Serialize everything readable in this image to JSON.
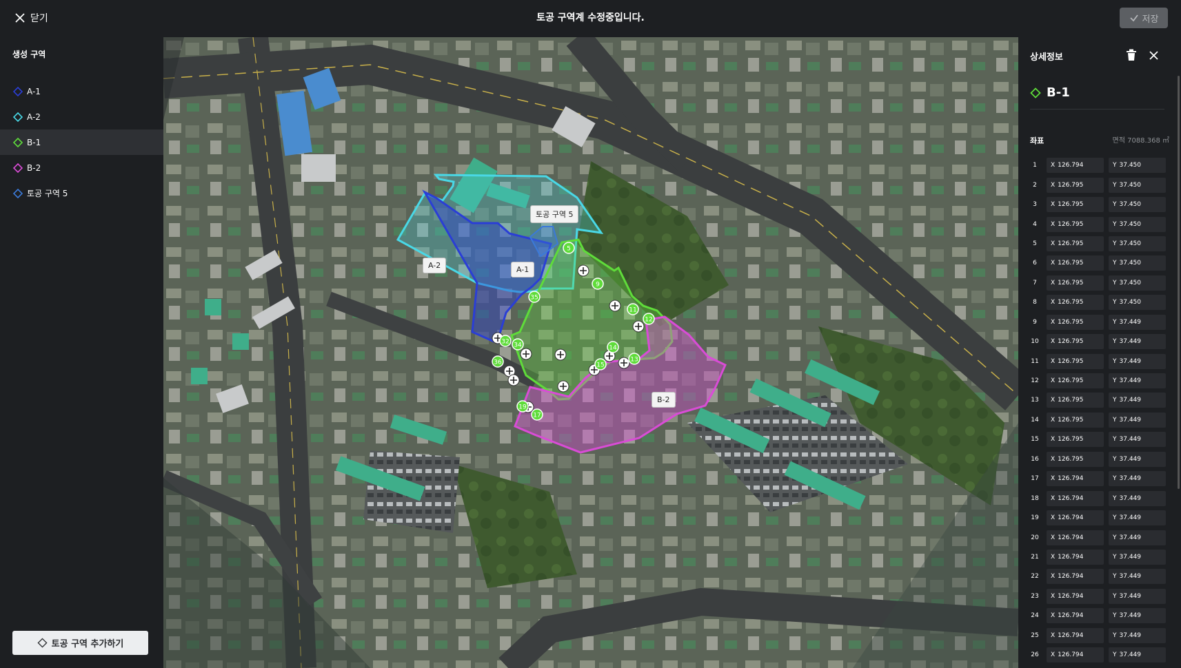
{
  "header": {
    "close_label": "닫기",
    "title": "토공 구역계 수정중입니다.",
    "save_label": "저장"
  },
  "sidebar": {
    "title": "생성 구역",
    "items": [
      {
        "label": "A-1",
        "color": "#2a3ed6"
      },
      {
        "label": "A-2",
        "color": "#49d8e6"
      },
      {
        "label": "B-1",
        "color": "#5fdc3a",
        "selected": true
      },
      {
        "label": "B-2",
        "color": "#d94cd6"
      },
      {
        "label": "토공 구역 5",
        "color": "#3b7ad9"
      }
    ],
    "add_button_label": "토공 구역 추가하기"
  },
  "map": {
    "labels": {
      "zone5": "토공 구역 5",
      "a2": "A-2",
      "a1": "A-1",
      "b2": "B-2"
    },
    "vertex_numbers": [
      "5",
      "9",
      "11",
      "12",
      "13",
      "14",
      "15",
      "17",
      "19",
      "32",
      "34",
      "35",
      "36"
    ]
  },
  "detail_panel": {
    "title": "상세정보",
    "zone_name": "B-1",
    "zone_color": "#5fdc3a",
    "coords_label": "좌표",
    "area_text": "면적 7088.368 ㎡",
    "coords": [
      {
        "i": "1",
        "x": "126.794",
        "y": "37.450"
      },
      {
        "i": "2",
        "x": "126.795",
        "y": "37.450"
      },
      {
        "i": "3",
        "x": "126.795",
        "y": "37.450"
      },
      {
        "i": "4",
        "x": "126.795",
        "y": "37.450"
      },
      {
        "i": "5",
        "x": "126.795",
        "y": "37.450"
      },
      {
        "i": "6",
        "x": "126.795",
        "y": "37.450"
      },
      {
        "i": "7",
        "x": "126.795",
        "y": "37.450"
      },
      {
        "i": "8",
        "x": "126.795",
        "y": "37.450"
      },
      {
        "i": "9",
        "x": "126.795",
        "y": "37.449"
      },
      {
        "i": "10",
        "x": "126.795",
        "y": "37.449"
      },
      {
        "i": "11",
        "x": "126.795",
        "y": "37.449"
      },
      {
        "i": "12",
        "x": "126.795",
        "y": "37.449"
      },
      {
        "i": "13",
        "x": "126.795",
        "y": "37.449"
      },
      {
        "i": "14",
        "x": "126.795",
        "y": "37.449"
      },
      {
        "i": "15",
        "x": "126.795",
        "y": "37.449"
      },
      {
        "i": "16",
        "x": "126.795",
        "y": "37.449"
      },
      {
        "i": "17",
        "x": "126.794",
        "y": "37.449"
      },
      {
        "i": "18",
        "x": "126.794",
        "y": "37.449"
      },
      {
        "i": "19",
        "x": "126.794",
        "y": "37.449"
      },
      {
        "i": "20",
        "x": "126.794",
        "y": "37.449"
      },
      {
        "i": "21",
        "x": "126.794",
        "y": "37.449"
      },
      {
        "i": "22",
        "x": "126.794",
        "y": "37.449"
      },
      {
        "i": "23",
        "x": "126.794",
        "y": "37.449"
      },
      {
        "i": "24",
        "x": "126.794",
        "y": "37.449"
      },
      {
        "i": "25",
        "x": "126.794",
        "y": "37.449"
      },
      {
        "i": "26",
        "x": "126.794",
        "y": "37.449"
      }
    ]
  }
}
